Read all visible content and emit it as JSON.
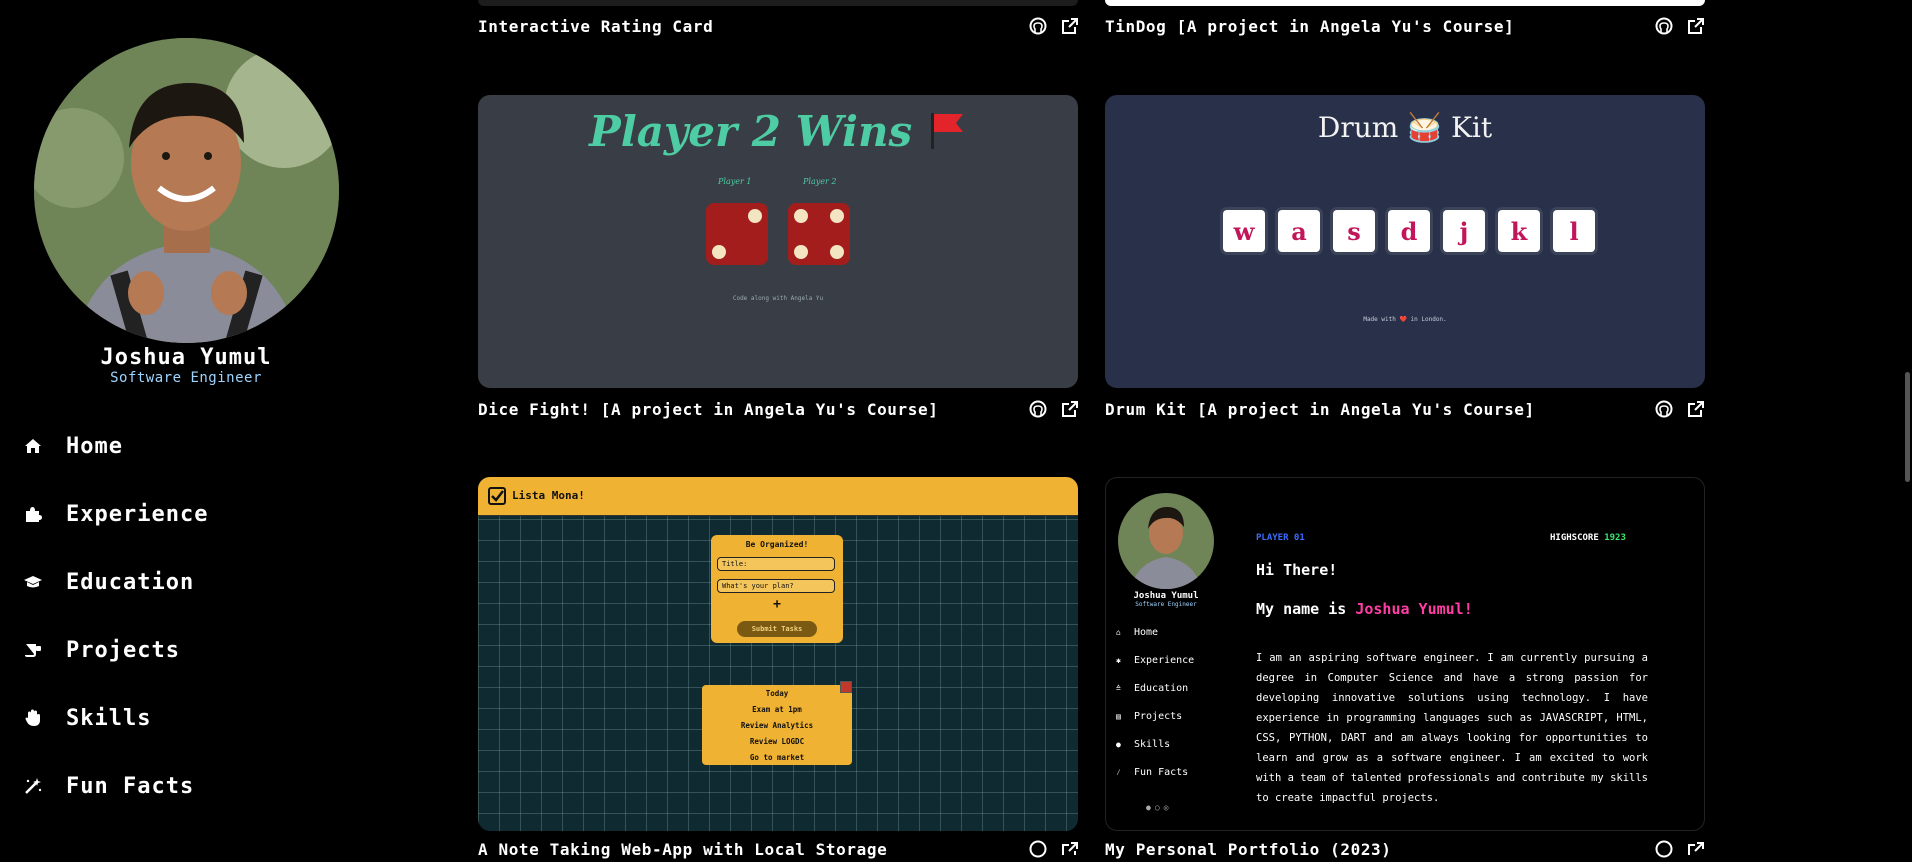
{
  "profile": {
    "name": "Joshua Yumul",
    "role": "Software Engineer"
  },
  "nav": [
    {
      "label": "Home",
      "icon": "home-icon"
    },
    {
      "label": "Experience",
      "icon": "puzzle-icon"
    },
    {
      "label": "Education",
      "icon": "graduation-cap-icon"
    },
    {
      "label": "Projects",
      "icon": "scroll-icon"
    },
    {
      "label": "Skills",
      "icon": "hand-icon"
    },
    {
      "label": "Fun Facts",
      "icon": "magic-wand-icon"
    }
  ],
  "projects": [
    {
      "title": "Interactive Rating Card"
    },
    {
      "title": "TinDog [A project in Angela Yu's Course]"
    },
    {
      "title": "Dice Fight! [A project in Angela Yu's Course]"
    },
    {
      "title": "Drum Kit [A project in Angela Yu's Course]"
    },
    {
      "title": "A Note Taking Web-App with Local Storage"
    },
    {
      "title": "My Personal Portfolio (2023)"
    }
  ],
  "dice_preview": {
    "heading": "Player 2 Wins",
    "player1": "Player 1",
    "player2": "Player 2",
    "footer": "Code along with Angela Yu"
  },
  "drum_preview": {
    "heading": "Drum 🥁 Kit",
    "keys": [
      "w",
      "a",
      "s",
      "d",
      "j",
      "k",
      "l"
    ],
    "footer": "Made with ❤️ in London."
  },
  "notes_preview": {
    "app_name": "Lista Mona!",
    "form_heading": "Be Organized!",
    "title_placeholder": "Title:",
    "plan_placeholder": "What's your plan?",
    "add_symbol": "+",
    "submit_label": "Submit Tasks",
    "list_heading": "Today",
    "tasks": [
      "Exam at 1pm",
      "Review Analytics",
      "Review LOGDC",
      "Go to market"
    ]
  },
  "portfolio_preview": {
    "player_label": "PLAYER 01",
    "highscore_label": "HIGHSCORE",
    "highscore_value": "1923",
    "greeting": "Hi There!",
    "name_intro": "My name is",
    "name_highlight": "Joshua Yumul!",
    "profile_name": "Joshua Yumul",
    "profile_role": "Software Engineer",
    "nav": [
      "Home",
      "Experience",
      "Education",
      "Projects",
      "Skills",
      "Fun Facts"
    ],
    "bio": "I am an aspiring software engineer. I am currently pursuing a degree in Computer Science and have a strong passion for developing innovative solutions using technology. I have experience in programming languages such as JAVASCRIPT, HTML, CSS, PYTHON, DART and am always looking for opportunities to learn and grow as a software engineer. I am excited to work with a team of talented professionals and contribute my skills to create impactful projects."
  },
  "colors": {
    "accent_blue": "#9fd4ff",
    "highlight_pink": "#ff3ea5",
    "highscore_green": "#3ee66b",
    "dice_green": "#4ecca3",
    "notes_yellow": "#f0b232"
  }
}
